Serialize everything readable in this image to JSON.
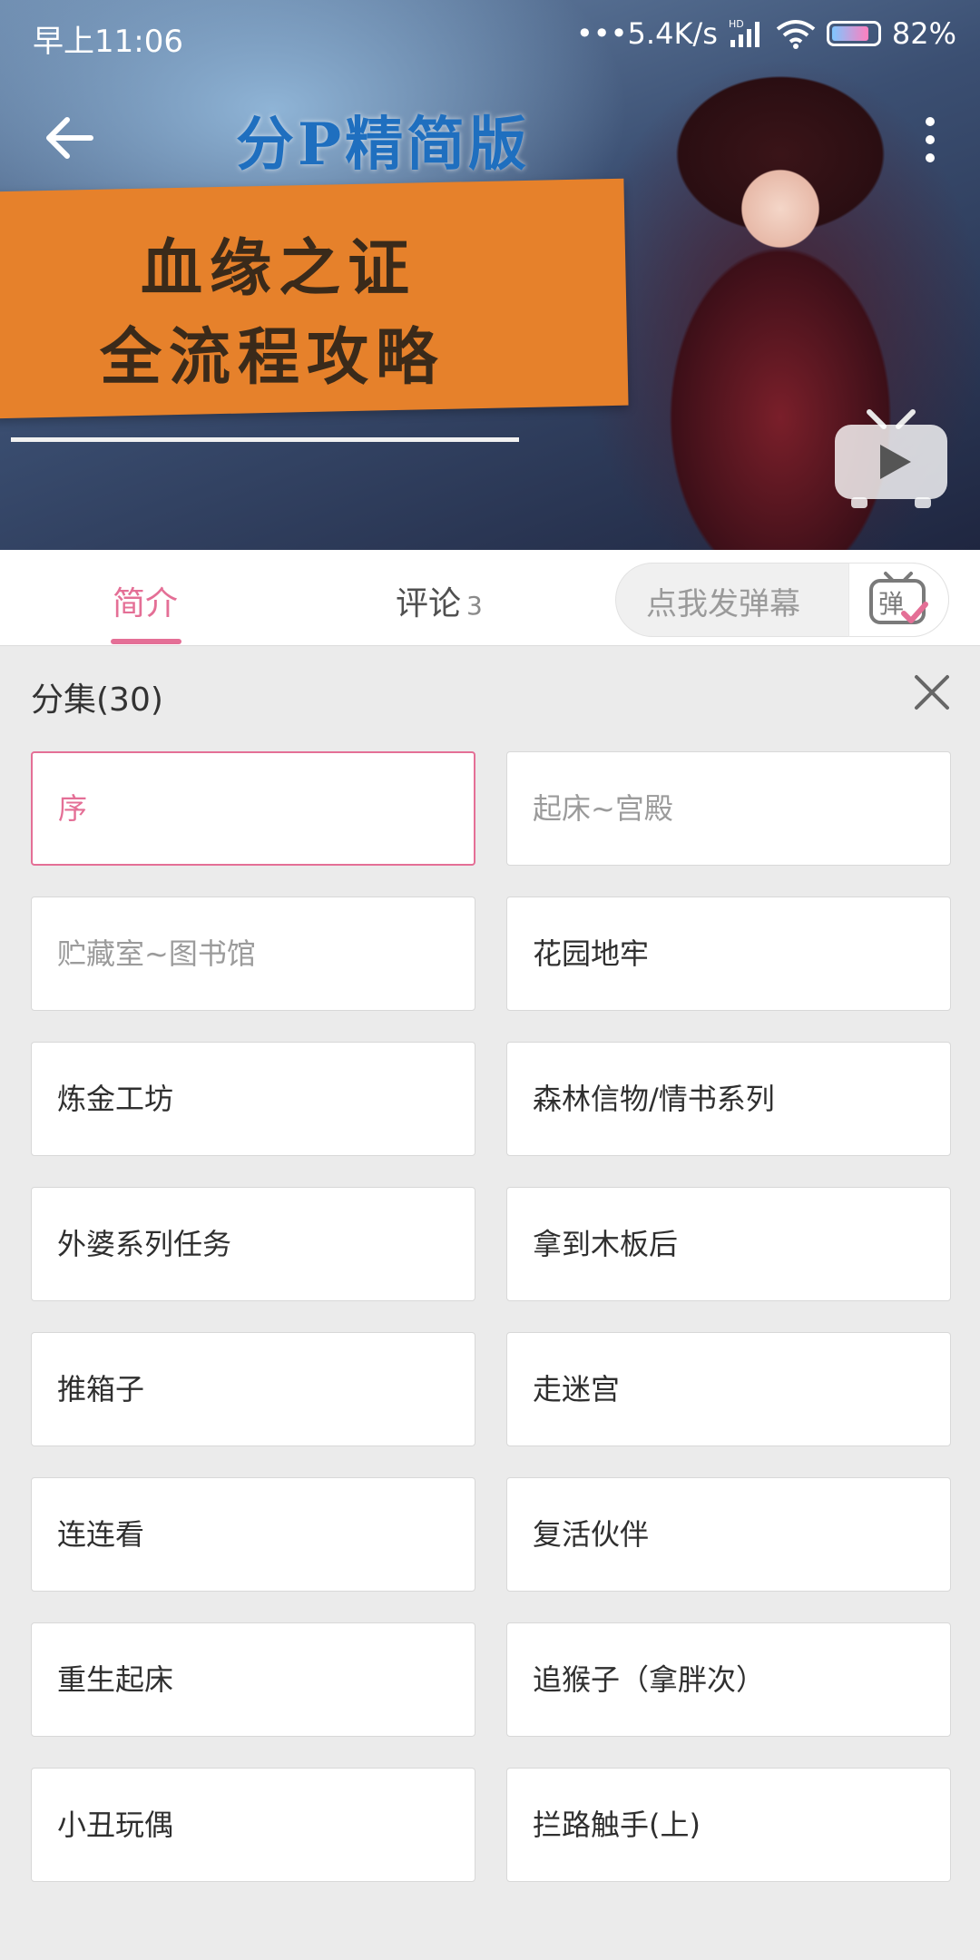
{
  "status_bar": {
    "time": "早上11:06",
    "net_speed": "•••5.4K/s",
    "signal": "HD",
    "battery": "82%"
  },
  "video": {
    "cover_title": "分P精简版",
    "banner_line_1": "血缘之证",
    "banner_line_2": "全流程攻略"
  },
  "tabs": {
    "intro": "简介",
    "comments": "评论",
    "comments_count": "3",
    "danmaku_placeholder": "点我发弹幕"
  },
  "panel": {
    "title": "分集(30)"
  },
  "colors": {
    "accent": "#e46f96",
    "background": "#ebebeb"
  },
  "episodes": [
    {
      "label": "序",
      "state": "current"
    },
    {
      "label": "起床~宫殿",
      "state": "watched"
    },
    {
      "label": "贮藏室~图书馆",
      "state": "watched"
    },
    {
      "label": "花园地牢",
      "state": "normal"
    },
    {
      "label": "炼金工坊",
      "state": "normal"
    },
    {
      "label": "森林信物/情书系列",
      "state": "normal"
    },
    {
      "label": "外婆系列任务",
      "state": "normal"
    },
    {
      "label": "拿到木板后",
      "state": "normal"
    },
    {
      "label": "推箱子",
      "state": "normal"
    },
    {
      "label": "走迷宫",
      "state": "normal"
    },
    {
      "label": "连连看",
      "state": "normal"
    },
    {
      "label": "复活伙伴",
      "state": "normal"
    },
    {
      "label": "重生起床",
      "state": "normal"
    },
    {
      "label": "追猴子（拿胖次）",
      "state": "normal"
    },
    {
      "label": "小丑玩偶",
      "state": "normal"
    },
    {
      "label": "拦路触手(上)",
      "state": "normal"
    }
  ]
}
